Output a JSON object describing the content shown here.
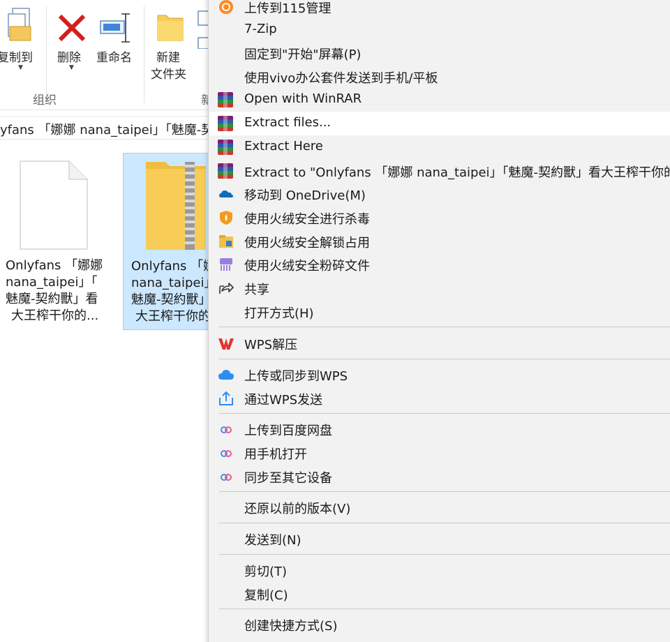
{
  "ribbon": {
    "copy_to": "复制到",
    "delete": "删除",
    "rename": "重命名",
    "new_folder_line1": "新建",
    "new_folder_line2": "文件夹",
    "group_organize": "组织",
    "new_group_partial": "新"
  },
  "pathbar": {
    "text": "yfans 「娜娜 nana_taipei」「魅魔-契"
  },
  "files": [
    {
      "line1": "Onlyfans 「娜娜",
      "line2": "nana_taipei」「",
      "line3": "魅魔-契約獸」看",
      "line4": "大王榨干你的...",
      "icon": "blank-file-icon"
    },
    {
      "line1": "Onlyfans 「娜",
      "line2": "nana_taipei」",
      "line3": "魅魔-契約獸」",
      "line4": "大王榨干你的",
      "icon": "zip-folder-icon"
    }
  ],
  "menu": {
    "items": [
      {
        "label": "上传到115管理",
        "icon": "115-icon"
      },
      {
        "label": "7-Zip",
        "icon": ""
      },
      {
        "label": "固定到\"开始\"屏幕(P)",
        "icon": ""
      },
      {
        "label": "使用vivo办公套件发送到手机/平板",
        "icon": ""
      },
      {
        "label": "Open with WinRAR",
        "icon": "winrar-icon"
      },
      {
        "label": "Extract files...",
        "icon": "winrar-icon"
      },
      {
        "label": "Extract Here",
        "icon": "winrar-icon"
      },
      {
        "label": "Extract to \"Onlyfans 「娜娜 nana_taipei」「魅魔-契約獸」看大王榨干你的",
        "icon": "winrar-icon"
      },
      {
        "label": "移动到 OneDrive(M)",
        "icon": "onedrive-icon"
      },
      {
        "label": "使用火绒安全进行杀毒",
        "icon": "huorong-shield-icon"
      },
      {
        "label": "使用火绒安全解锁占用",
        "icon": "huorong-unlock-icon"
      },
      {
        "label": "使用火绒安全粉碎文件",
        "icon": "huorong-shred-icon"
      },
      {
        "label": "共享",
        "icon": "share-icon"
      },
      {
        "label": "打开方式(H)",
        "icon": ""
      },
      {
        "label": "WPS解压",
        "icon": "wps-icon"
      },
      {
        "label": "上传或同步到WPS",
        "icon": "wps-cloud-icon"
      },
      {
        "label": "通过WPS发送",
        "icon": "wps-send-icon"
      },
      {
        "label": "上传到百度网盘",
        "icon": "baidu-icon"
      },
      {
        "label": "用手机打开",
        "icon": "baidu-icon"
      },
      {
        "label": "同步至其它设备",
        "icon": "baidu-icon"
      },
      {
        "label": "还原以前的版本(V)",
        "icon": ""
      },
      {
        "label": "发送到(N)",
        "icon": ""
      },
      {
        "label": "剪切(T)",
        "icon": ""
      },
      {
        "label": "复制(C)",
        "icon": ""
      },
      {
        "label": "创建快捷方式(S)",
        "icon": ""
      }
    ],
    "hovered_item": "Extract files..."
  },
  "colors": {
    "selection_bg": "#cce8ff",
    "selection_border": "#99d1ff",
    "menu_bg": "#f2f2f2",
    "hover_bg": "#ffffff",
    "delete_red": "#d0211c",
    "folder_yellow": "#f7cd58"
  }
}
